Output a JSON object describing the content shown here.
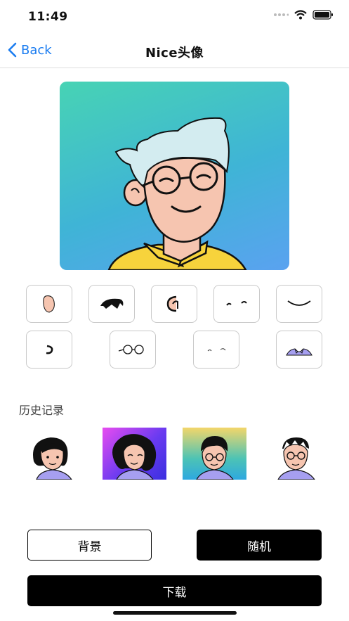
{
  "status": {
    "time": "11:49"
  },
  "nav": {
    "back_label": "Back",
    "title": "Nice头像"
  },
  "history": {
    "title": "历史记录"
  },
  "buttons": {
    "background": "背景",
    "random": "随机",
    "download": "下载"
  },
  "colors": {
    "accent": "#1a7cf0",
    "avatar_bg_start": "#47d3b4",
    "avatar_bg_end": "#5aa2f0",
    "shirt": "#f7d33c"
  }
}
